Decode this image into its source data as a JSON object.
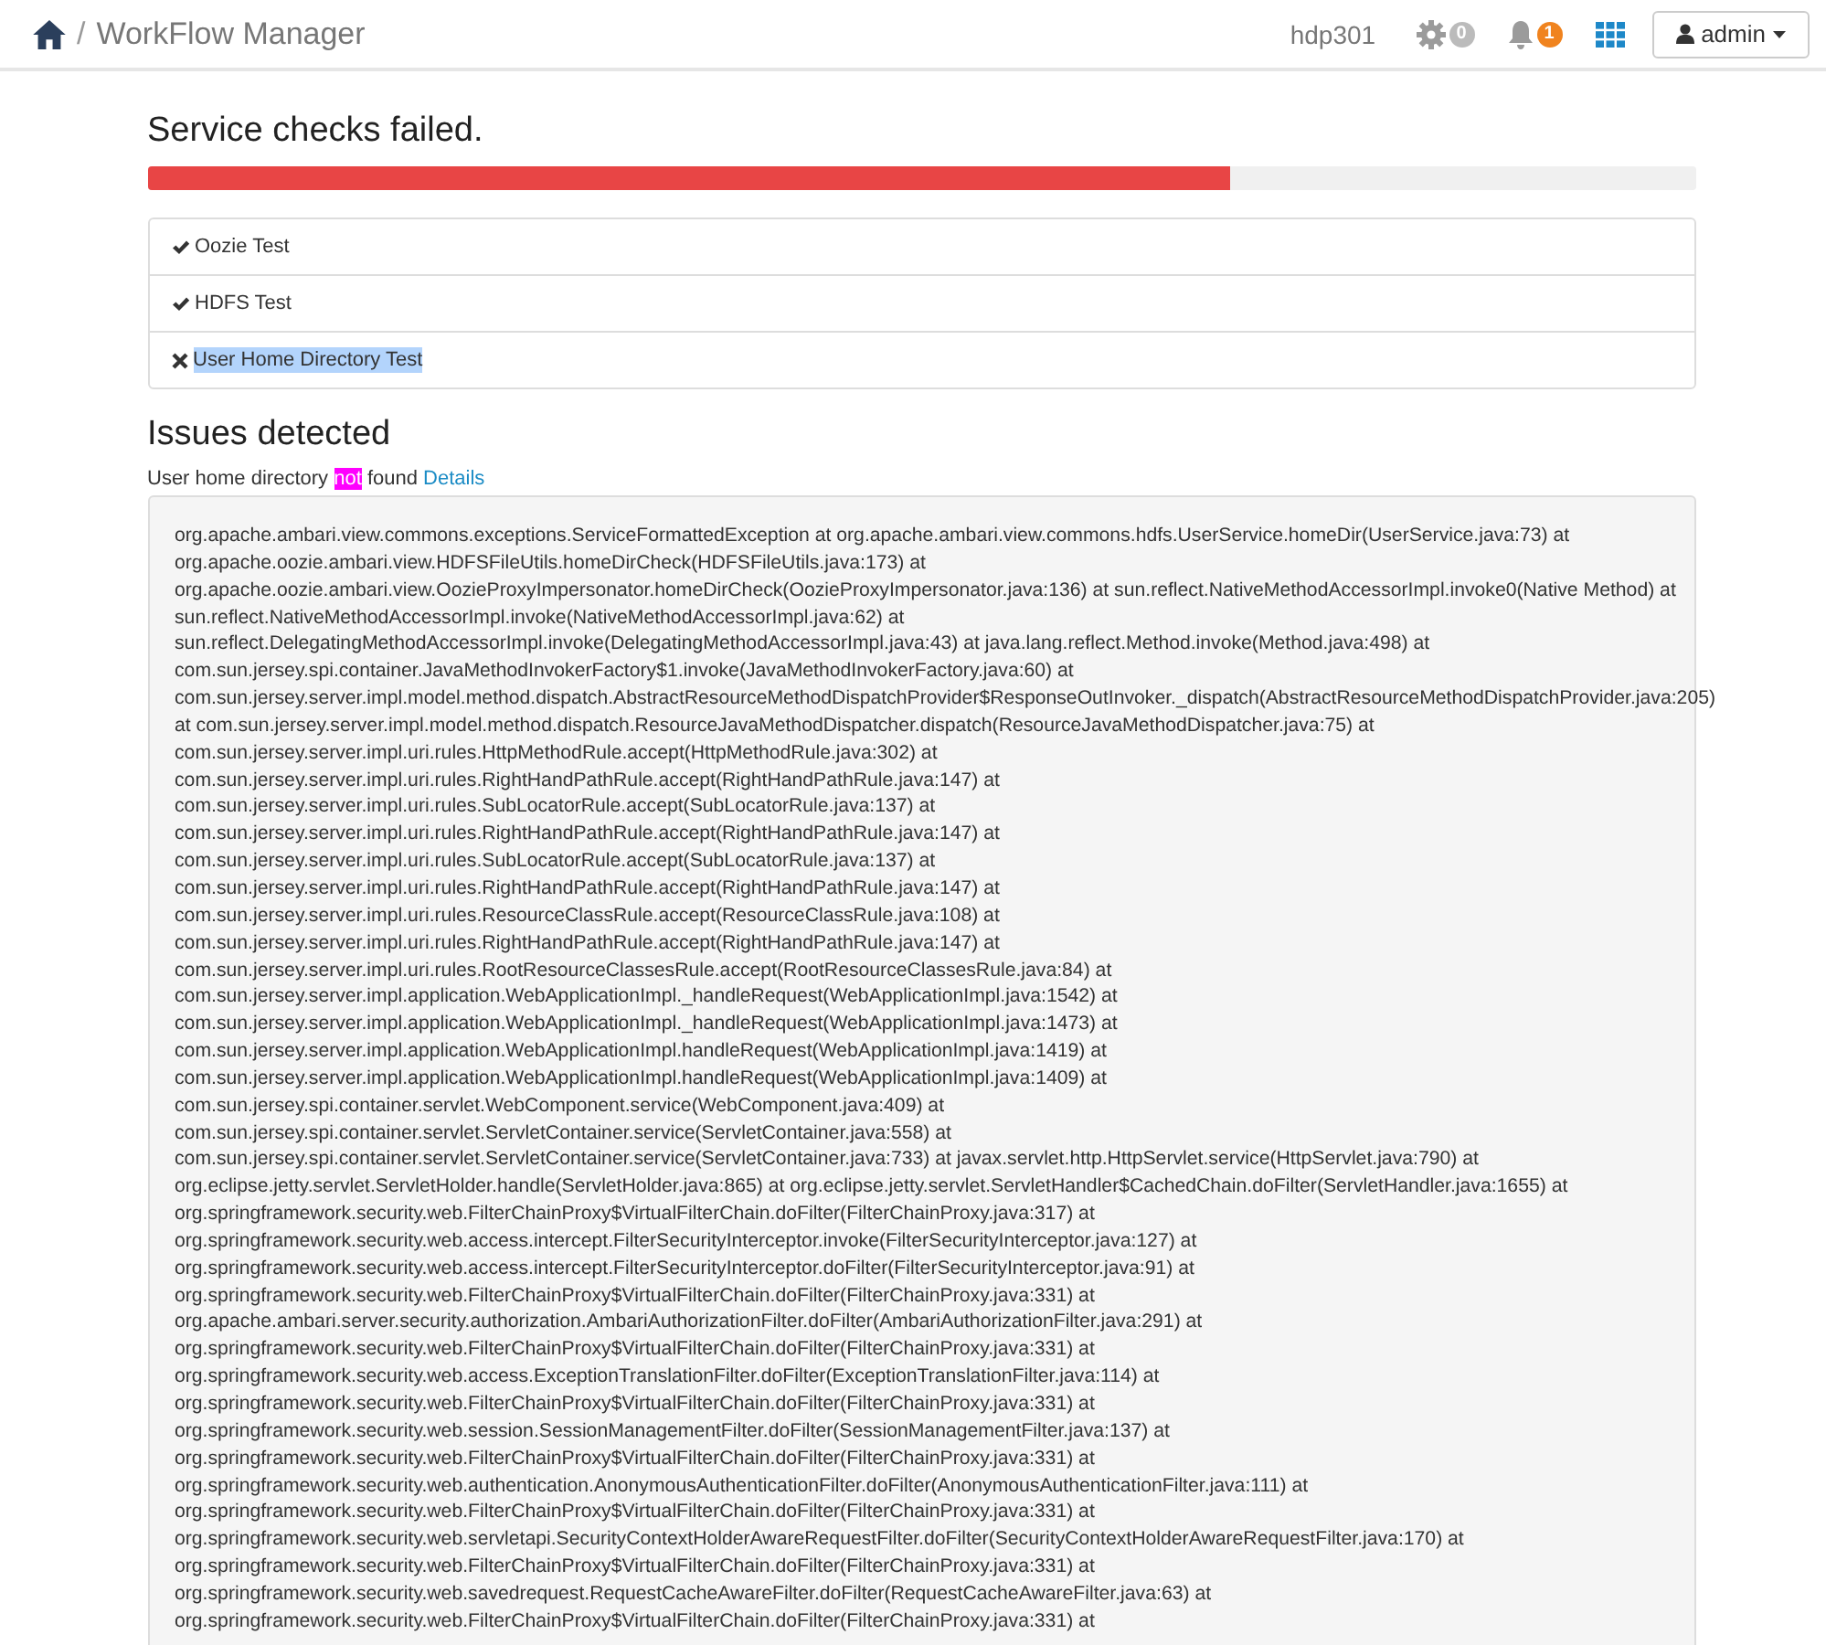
{
  "navbar": {
    "separator": "/",
    "title": "WorkFlow Manager",
    "cluster": "hdp301",
    "ops_count": "0",
    "alerts_count": "1",
    "user": "admin"
  },
  "checks": {
    "title": "Service checks failed.",
    "level": 0.7,
    "items": [
      {
        "label": "Oozie Test",
        "passed": true,
        "highlighted": false
      },
      {
        "label": "HDFS Test",
        "passed": true,
        "highlighted": false
      },
      {
        "label": "User Home Directory Test",
        "passed": false,
        "highlighted": true
      }
    ]
  },
  "issues": {
    "title": "Issues detected",
    "message_before": "User home directory",
    "message_marked": "not",
    "message_after": "found",
    "link": "Details",
    "trace_lines": [
      "org.apache.ambari.view.commons.exceptions.ServiceFormattedException at org.apache.ambari.view.commons.hdfs.UserService.homeDir(UserService.java:73) at",
      "org.apache.oozie.ambari.view.HDFSFileUtils.homeDirCheck(HDFSFileUtils.java:173) at",
      "org.apache.oozie.ambari.view.OozieProxyImpersonator.homeDirCheck(OozieProxyImpersonator.java:136) at sun.reflect.NativeMethodAccessorImpl.invoke0(Native Method) at",
      "sun.reflect.NativeMethodAccessorImpl.invoke(NativeMethodAccessorImpl.java:62) at",
      "sun.reflect.DelegatingMethodAccessorImpl.invoke(DelegatingMethodAccessorImpl.java:43) at java.lang.reflect.Method.invoke(Method.java:498) at",
      "com.sun.jersey.spi.container.JavaMethodInvokerFactory$1.invoke(JavaMethodInvokerFactory.java:60) at",
      "com.sun.jersey.server.impl.model.method.dispatch.AbstractResourceMethodDispatchProvider$ResponseOutInvoker._dispatch(AbstractResourceMethodDispatchProvider.java:205)",
      "at com.sun.jersey.server.impl.model.method.dispatch.ResourceJavaMethodDispatcher.dispatch(ResourceJavaMethodDispatcher.java:75) at",
      "com.sun.jersey.server.impl.uri.rules.HttpMethodRule.accept(HttpMethodRule.java:302) at",
      "com.sun.jersey.server.impl.uri.rules.RightHandPathRule.accept(RightHandPathRule.java:147) at",
      "com.sun.jersey.server.impl.uri.rules.SubLocatorRule.accept(SubLocatorRule.java:137) at",
      "com.sun.jersey.server.impl.uri.rules.RightHandPathRule.accept(RightHandPathRule.java:147) at",
      "com.sun.jersey.server.impl.uri.rules.SubLocatorRule.accept(SubLocatorRule.java:137) at",
      "com.sun.jersey.server.impl.uri.rules.RightHandPathRule.accept(RightHandPathRule.java:147) at",
      "com.sun.jersey.server.impl.uri.rules.ResourceClassRule.accept(ResourceClassRule.java:108) at",
      "com.sun.jersey.server.impl.uri.rules.RightHandPathRule.accept(RightHandPathRule.java:147) at",
      "com.sun.jersey.server.impl.uri.rules.RootResourceClassesRule.accept(RootResourceClassesRule.java:84) at",
      "com.sun.jersey.server.impl.application.WebApplicationImpl._handleRequest(WebApplicationImpl.java:1542) at",
      "com.sun.jersey.server.impl.application.WebApplicationImpl._handleRequest(WebApplicationImpl.java:1473) at",
      "com.sun.jersey.server.impl.application.WebApplicationImpl.handleRequest(WebApplicationImpl.java:1419) at",
      "com.sun.jersey.server.impl.application.WebApplicationImpl.handleRequest(WebApplicationImpl.java:1409) at",
      "com.sun.jersey.spi.container.servlet.WebComponent.service(WebComponent.java:409) at",
      "com.sun.jersey.spi.container.servlet.ServletContainer.service(ServletContainer.java:558) at",
      "com.sun.jersey.spi.container.servlet.ServletContainer.service(ServletContainer.java:733) at javax.servlet.http.HttpServlet.service(HttpServlet.java:790) at",
      "org.eclipse.jetty.servlet.ServletHolder.handle(ServletHolder.java:865) at org.eclipse.jetty.servlet.ServletHandler$CachedChain.doFilter(ServletHandler.java:1655) at",
      "org.springframework.security.web.FilterChainProxy$VirtualFilterChain.doFilter(FilterChainProxy.java:317) at",
      "org.springframework.security.web.access.intercept.FilterSecurityInterceptor.invoke(FilterSecurityInterceptor.java:127) at",
      "org.springframework.security.web.access.intercept.FilterSecurityInterceptor.doFilter(FilterSecurityInterceptor.java:91) at",
      "org.springframework.security.web.FilterChainProxy$VirtualFilterChain.doFilter(FilterChainProxy.java:331) at",
      "org.apache.ambari.server.security.authorization.AmbariAuthorizationFilter.doFilter(AmbariAuthorizationFilter.java:291) at",
      "org.springframework.security.web.FilterChainProxy$VirtualFilterChain.doFilter(FilterChainProxy.java:331) at",
      "org.springframework.security.web.access.ExceptionTranslationFilter.doFilter(ExceptionTranslationFilter.java:114) at",
      "org.springframework.security.web.FilterChainProxy$VirtualFilterChain.doFilter(FilterChainProxy.java:331) at",
      "org.springframework.security.web.session.SessionManagementFilter.doFilter(SessionManagementFilter.java:137) at",
      "org.springframework.security.web.FilterChainProxy$VirtualFilterChain.doFilter(FilterChainProxy.java:331) at",
      "org.springframework.security.web.authentication.AnonymousAuthenticationFilter.doFilter(AnonymousAuthenticationFilter.java:111) at",
      "org.springframework.security.web.FilterChainProxy$VirtualFilterChain.doFilter(FilterChainProxy.java:331) at",
      "org.springframework.security.web.servletapi.SecurityContextHolderAwareRequestFilter.doFilter(SecurityContextHolderAwareRequestFilter.java:170) at",
      "org.springframework.security.web.FilterChainProxy$VirtualFilterChain.doFilter(FilterChainProxy.java:331) at",
      "org.springframework.security.web.savedrequest.RequestCacheAwareFilter.doFilter(RequestCacheAwareFilter.java:63) at",
      "org.springframework.security.web.FilterChainProxy$VirtualFilterChain.doFilter(FilterChainProxy.java:331) at"
    ]
  }
}
